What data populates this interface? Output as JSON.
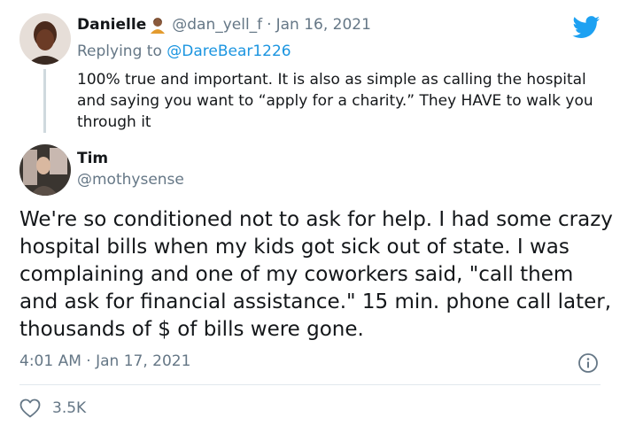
{
  "parent_tweet": {
    "display_name": "Danielle",
    "handle": "@dan_yell_f",
    "separator": "·",
    "date": "Jan 16, 2021",
    "replying_prefix": "Replying to",
    "replying_to": "@DareBear1226",
    "text": "100% true and important. It is also as simple as calling the hospital and saying you want to “apply for a charity.” They HAVE to walk you through it",
    "avatar_icon": "user-avatar-photo",
    "name_emoji_icon": "woman-emoji-icon"
  },
  "main_tweet": {
    "display_name": "Tim",
    "handle": "@mothysense",
    "text": "We're so conditioned not to ask for help. I had some crazy hospital bills when my kids got sick out of state. I was complaining and one of my coworkers said, \"call them and ask for financial assistance.\" 15 min. phone call later, thousands of $ of bills were gone.",
    "timestamp": "4:01 AM · Jan 17, 2021",
    "like_count": "3.5K",
    "avatar_icon": "user-avatar-photo"
  },
  "brand": {
    "logo_icon": "twitter-bird-icon",
    "accent_color": "#1da1f2",
    "muted_color": "#657786",
    "link_color": "#1b95e0"
  }
}
